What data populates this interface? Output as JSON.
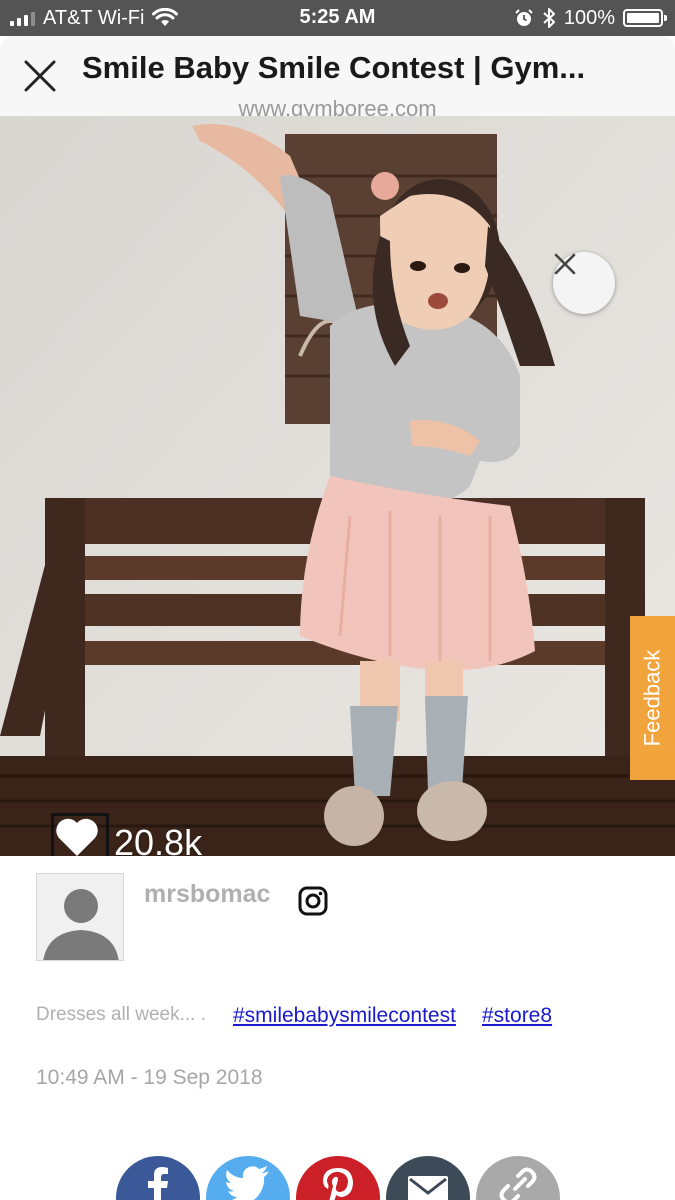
{
  "status": {
    "carrier": "AT&T Wi-Fi",
    "time": "5:25 AM",
    "battery": "100%",
    "battery_level": 1.0,
    "icons": [
      "signal-icon",
      "wifi-icon",
      "alarm-icon",
      "bluetooth-icon",
      "battery-icon"
    ]
  },
  "header": {
    "title": "Smile Baby Smile Contest | Gym...",
    "url": "www.gymboree.com",
    "close_icon": "close-icon"
  },
  "photo": {
    "likes": "20.8k",
    "like_icon": "heart-icon",
    "close_icon": "close-icon",
    "feedback_label": "Feedback"
  },
  "post": {
    "username": "mrsbomac",
    "platform_icon": "instagram-icon",
    "caption": "Dresses all week... .",
    "hashtags": [
      "#smilebabysmilecontest",
      "#store8"
    ],
    "timestamp": "10:49 AM - 19 Sep 2018"
  },
  "share": [
    {
      "icon": "facebook-icon",
      "color": "#3b5998"
    },
    {
      "icon": "twitter-icon",
      "color": "#55acee"
    },
    {
      "icon": "pinterest-icon",
      "color": "#cb2027"
    },
    {
      "icon": "mail-icon",
      "color": "#3d4a57"
    },
    {
      "icon": "link-icon",
      "color": "#a9a9a9"
    }
  ],
  "colors": {
    "statusbar": "#545454",
    "feedback": "#f0a43b",
    "hashtag_link": "#1a1acc"
  }
}
